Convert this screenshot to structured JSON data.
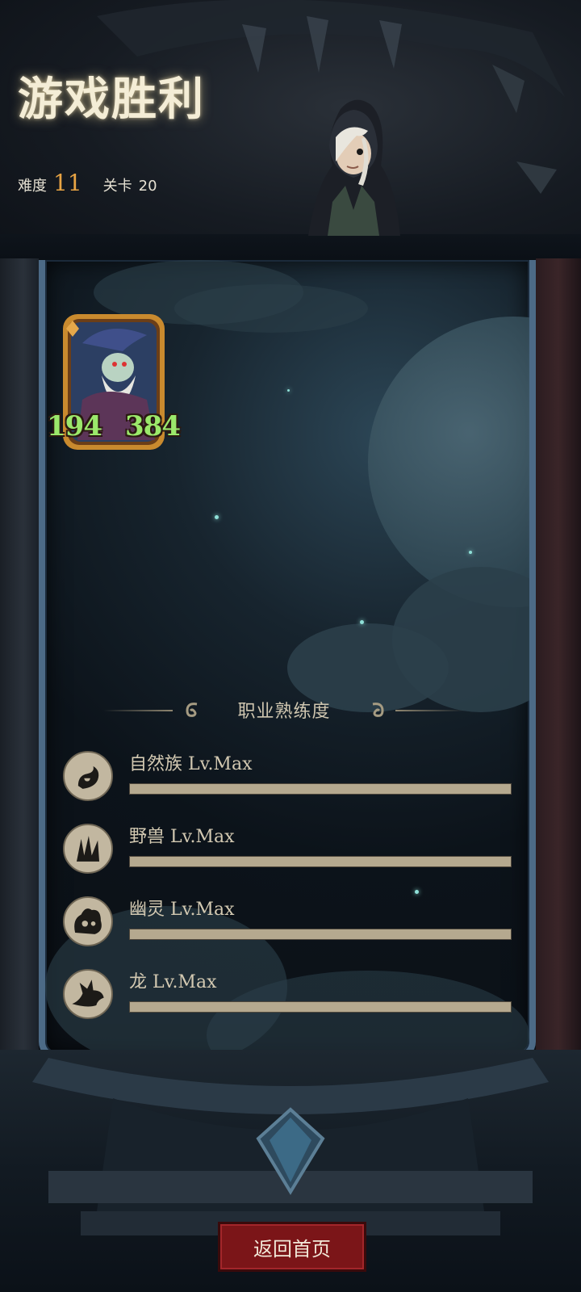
{
  "header": {
    "title": "游戏胜利",
    "difficulty_label": "难度",
    "difficulty_value": "11",
    "stage_label": "关卡",
    "stage_value": "20"
  },
  "unit_card": {
    "attack": "194",
    "health": "384"
  },
  "proficiency": {
    "title": "职业熟练度",
    "items": [
      {
        "name": "自然族",
        "level": "Lv.Max",
        "progress": 1.0,
        "icon": "nature-tribe-icon"
      },
      {
        "name": "野兽",
        "level": "Lv.Max",
        "progress": 1.0,
        "icon": "beast-claw-icon"
      },
      {
        "name": "幽灵",
        "level": "Lv.Max",
        "progress": 1.0,
        "icon": "ghost-flame-icon"
      },
      {
        "name": "龙",
        "level": "Lv.Max",
        "progress": 1.0,
        "icon": "dragon-head-icon"
      }
    ]
  },
  "footer": {
    "return_label": "返回首页"
  },
  "colors": {
    "accent_orange": "#e8a444",
    "stat_green": "#9be86b",
    "button_red": "#7b1518",
    "bar_fill": "#b5a98f"
  }
}
